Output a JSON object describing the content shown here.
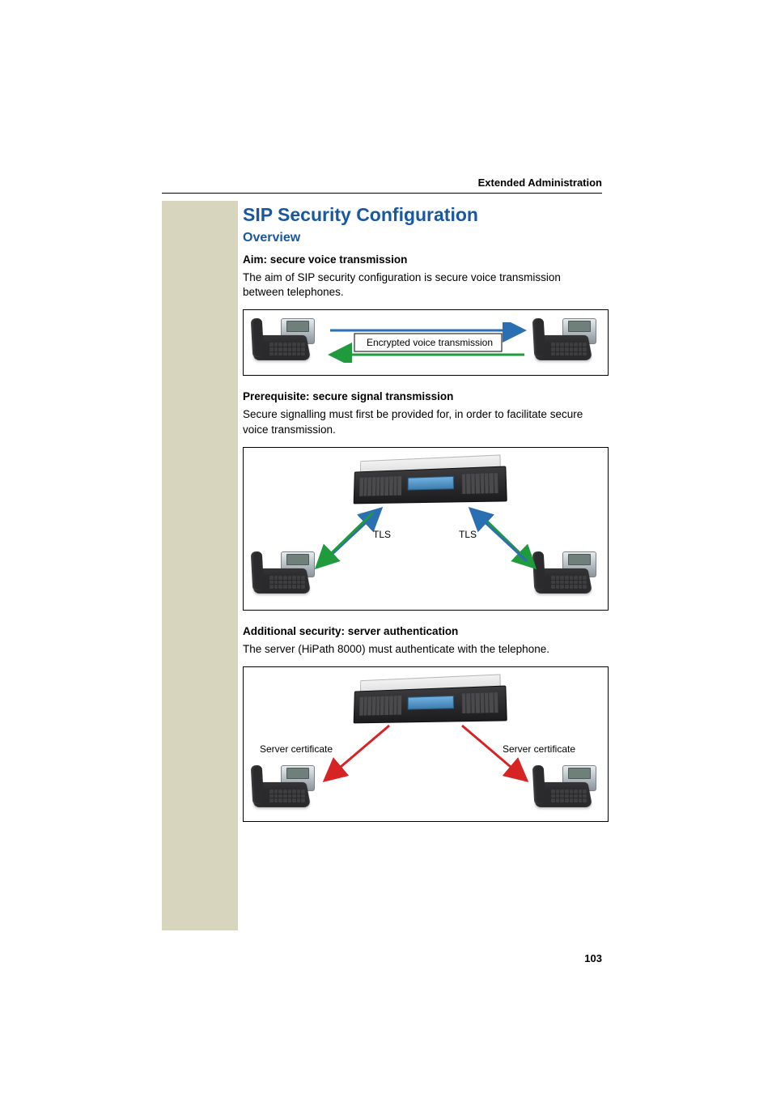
{
  "header": "Extended Administration",
  "title": "SIP Security Configuration",
  "section": "Overview",
  "sub1_heading": "Aim: secure voice transmission",
  "sub1_body": "The aim of SIP security configuration is secure voice transmission between telephones.",
  "diagram1": {
    "label": "Encrypted voice transmission"
  },
  "sub2_heading": "Prerequisite: secure signal transmission",
  "sub2_body": "Secure signalling must first be provided for, in order to facilitate secure voice transmission.",
  "diagram2": {
    "label_left": "TLS",
    "label_right": "TLS"
  },
  "sub3_heading": "Additional security: server authentication",
  "sub3_body": "The server (HiPath 8000) must authenticate with the telephone.",
  "diagram3": {
    "label_left": "Server certificate",
    "label_right": "Server certificate"
  },
  "page_number": "103",
  "colors": {
    "heading_blue": "#1958a0",
    "arrow_blue": "#2a6fb2",
    "arrow_green": "#1f9a3c",
    "arrow_red": "#d62424",
    "sidebar": "#d8d5bf"
  }
}
